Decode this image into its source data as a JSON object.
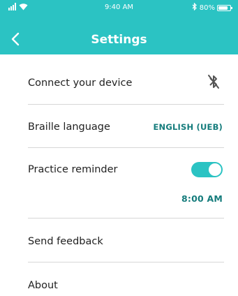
{
  "status_bar": {
    "time": "9:40 AM",
    "battery": "80%",
    "battery_level": 0.8
  },
  "header": {
    "title": "Settings"
  },
  "settings": {
    "connect_device": {
      "label": "Connect your device",
      "icon": "bluetooth-off-icon"
    },
    "braille_language": {
      "label": "Braille language",
      "value": "ENGLISH (UEB)"
    },
    "practice_reminder": {
      "label": "Practice reminder",
      "enabled": true,
      "time": "8:00 AM"
    },
    "send_feedback": {
      "label": "Send feedback"
    },
    "about": {
      "label": "About"
    }
  },
  "colors": {
    "accent": "#2BC3C3",
    "value_text": "#157C7C"
  }
}
